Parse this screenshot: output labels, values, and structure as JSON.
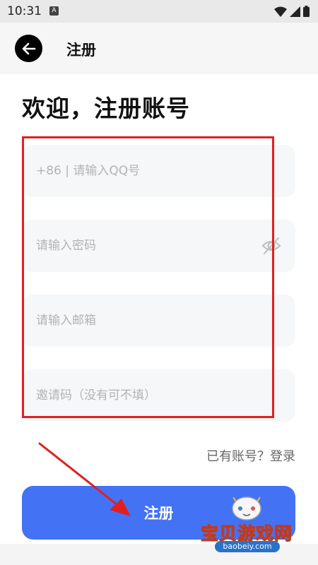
{
  "status_bar": {
    "time": "10:31",
    "notification_icon_letter": "A",
    "icons": [
      "wifi-icon",
      "signal-icon",
      "battery-icon"
    ]
  },
  "app_bar": {
    "back_icon": "arrow-left-icon",
    "title": "注册"
  },
  "welcome_heading": "欢迎，注册账号",
  "form": {
    "qq_placeholder": "+86 | 请输入QQ号",
    "password_placeholder": "请输入密码",
    "password_toggle_icon": "eye-off-icon",
    "email_placeholder": "请输入邮箱",
    "invite_placeholder": "邀请码（没有可不填）"
  },
  "login_link": "已有账号？登录",
  "register_button": "注册",
  "watermark": {
    "text": "宝贝游戏网",
    "url": "baobeiy.com"
  },
  "colors": {
    "primary": "#4372f5",
    "annotation_red": "#e02020",
    "field_bg": "#f6f7f9"
  }
}
